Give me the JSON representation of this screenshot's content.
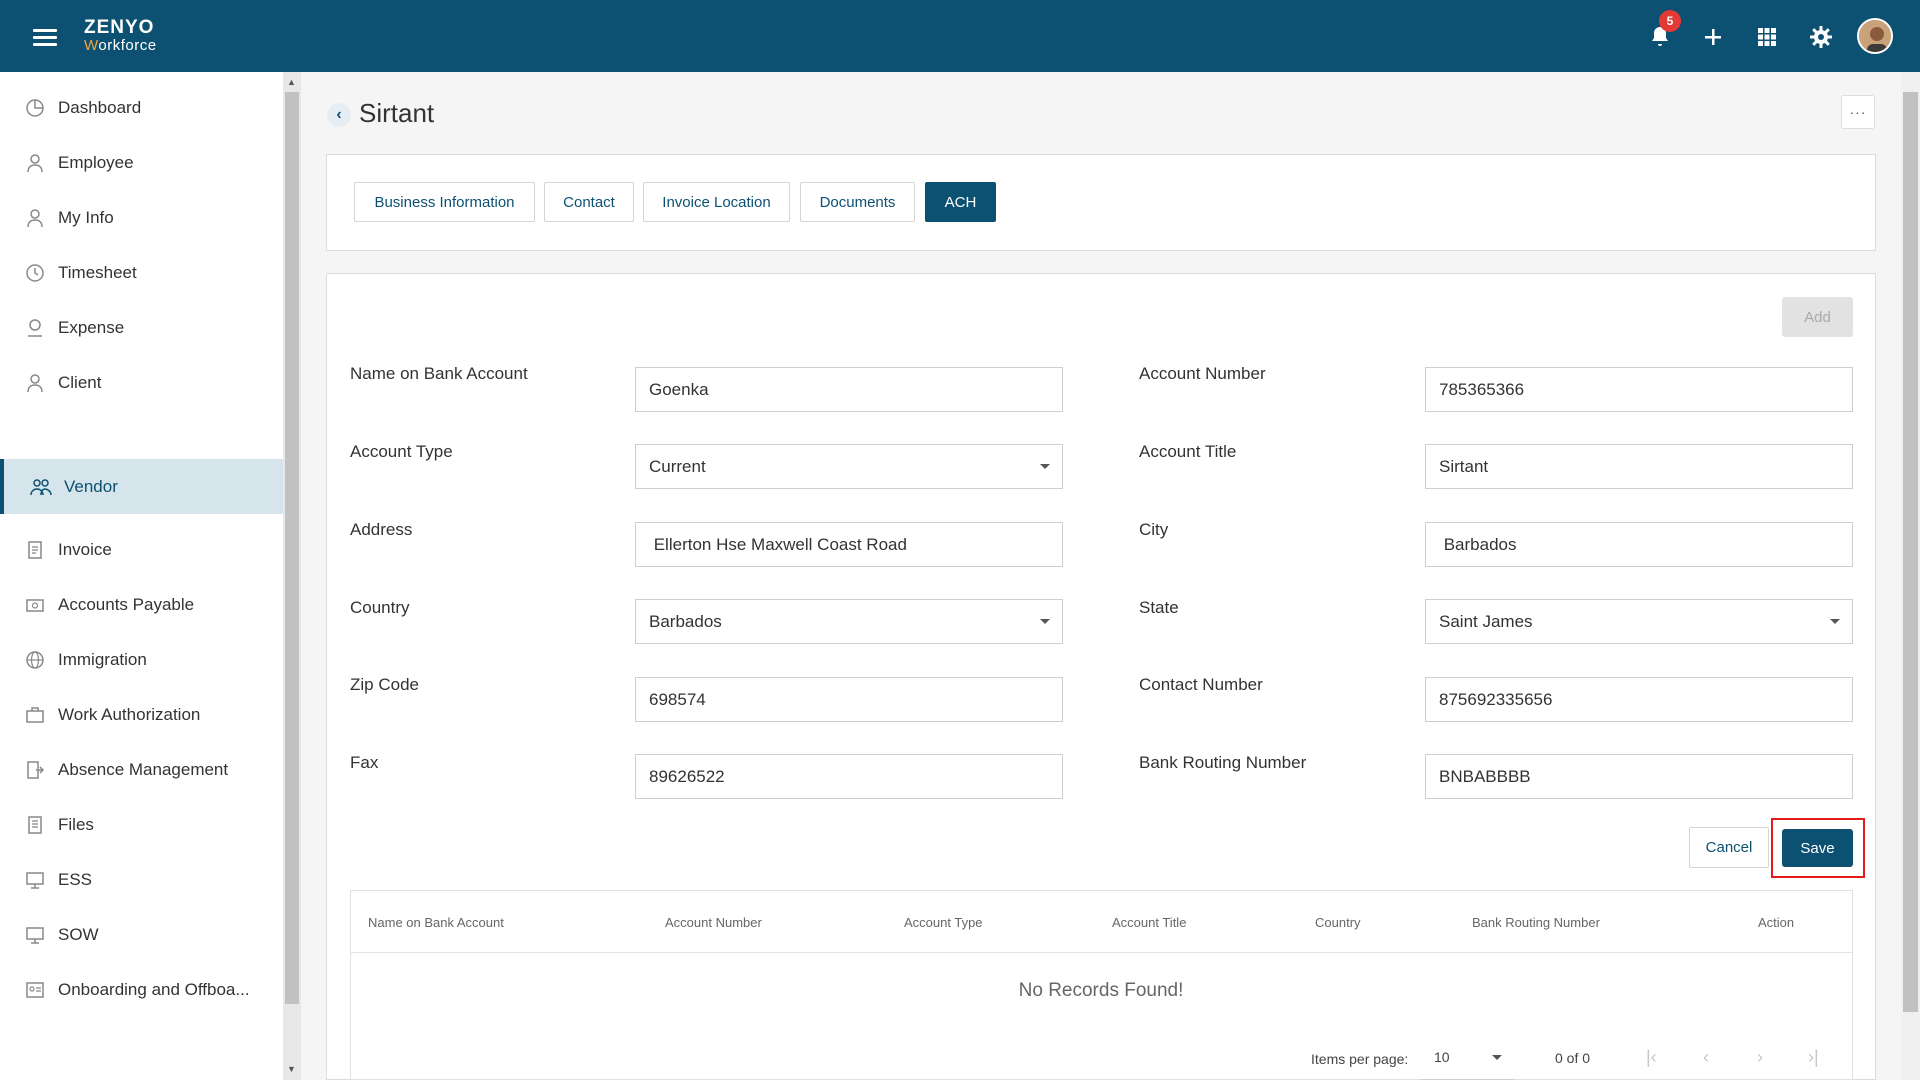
{
  "header": {
    "logo_top": "ZENYO",
    "logo_bottom_accent": "W",
    "logo_bottom": "orkforce",
    "notification_count": "5"
  },
  "sidebar": {
    "items": [
      {
        "label": "Dashboard",
        "icon": "dashboard-icon"
      },
      {
        "label": "Employee",
        "icon": "employee-icon"
      },
      {
        "label": "My Info",
        "icon": "my-info-icon"
      },
      {
        "label": "Timesheet",
        "icon": "clock-icon"
      },
      {
        "label": "Expense",
        "icon": "expense-icon"
      },
      {
        "label": "Client",
        "icon": "client-icon"
      },
      {
        "label": "Vendor",
        "icon": "vendor-icon",
        "active": true
      },
      {
        "label": "Invoice",
        "icon": "invoice-icon"
      },
      {
        "label": "Accounts Payable",
        "icon": "accounts-payable-icon"
      },
      {
        "label": "Immigration",
        "icon": "globe-icon"
      },
      {
        "label": "Work Authorization",
        "icon": "briefcase-icon"
      },
      {
        "label": "Absence Management",
        "icon": "absence-icon"
      },
      {
        "label": "Files",
        "icon": "files-icon"
      },
      {
        "label": "ESS",
        "icon": "ess-icon"
      },
      {
        "label": "SOW",
        "icon": "sow-icon"
      },
      {
        "label": "Onboarding and Offboa...",
        "icon": "onboarding-icon"
      }
    ]
  },
  "page": {
    "title": "Sirtant",
    "more": "···"
  },
  "tabs": [
    {
      "label": "Business Information"
    },
    {
      "label": "Contact"
    },
    {
      "label": "Invoice Location"
    },
    {
      "label": "Documents"
    },
    {
      "label": "ACH",
      "active": true
    }
  ],
  "form": {
    "add_label": "Add",
    "name_on_bank_account": {
      "label": "Name on Bank Account",
      "value": "Goenka"
    },
    "account_number": {
      "label": "Account Number",
      "value": "785365366"
    },
    "account_type": {
      "label": "Account Type",
      "value": "Current"
    },
    "account_title": {
      "label": "Account Title",
      "value": "Sirtant"
    },
    "address": {
      "label": "Address",
      "value": " Ellerton Hse Maxwell Coast Road"
    },
    "city": {
      "label": "City",
      "value": " Barbados"
    },
    "country": {
      "label": "Country",
      "value": "Barbados"
    },
    "state": {
      "label": "State",
      "value": "Saint James"
    },
    "zip_code": {
      "label": "Zip Code",
      "value": "698574"
    },
    "contact_number": {
      "label": "Contact Number",
      "value": "875692335656"
    },
    "fax": {
      "label": "Fax",
      "value": "89626522"
    },
    "bank_routing_number": {
      "label": "Bank Routing Number",
      "value": "BNBABBBB"
    },
    "cancel_label": "Cancel",
    "save_label": "Save"
  },
  "table": {
    "columns": [
      "Name on Bank Account",
      "Account Number",
      "Account Type",
      "Account Title",
      "Country",
      "Bank Routing Number",
      "Action"
    ],
    "empty_message": "No Records Found!",
    "items_per_page_label": "Items per page:",
    "items_per_page": "10",
    "range": "0 of 0"
  },
  "colors": {
    "brand": "#0d5172",
    "highlight": "#e21b1b",
    "badge": "#e53935"
  }
}
